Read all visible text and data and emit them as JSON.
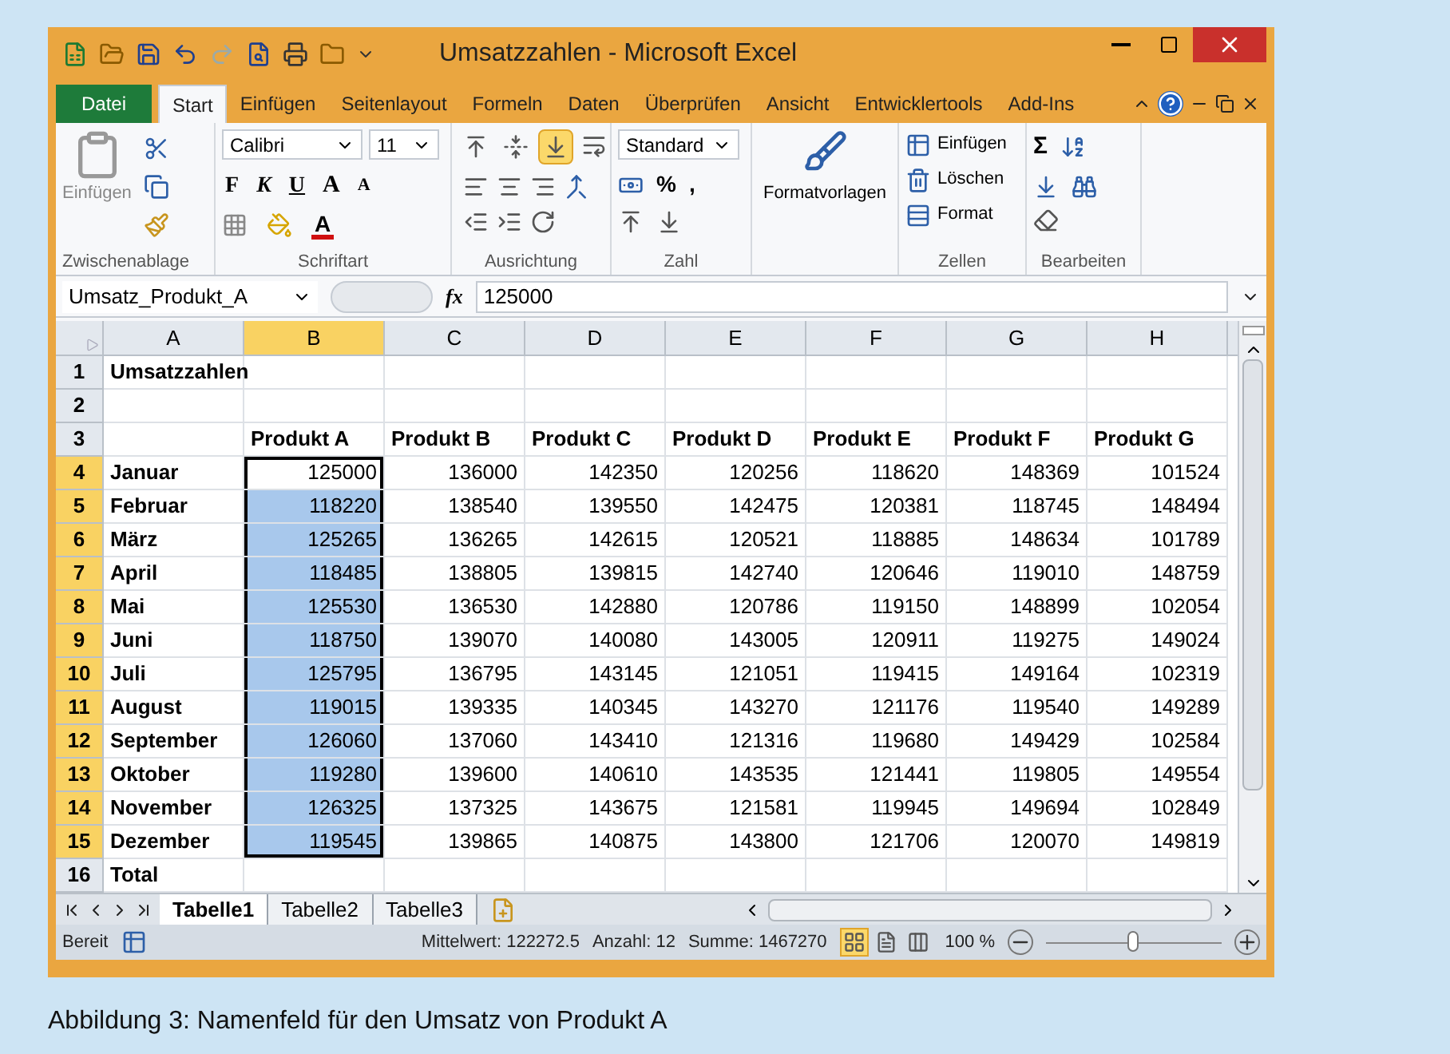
{
  "window": {
    "title": "Umsatzzahlen - Microsoft Excel"
  },
  "tabs": [
    {
      "label": "Datei",
      "kind": "file",
      "selected": false
    },
    {
      "label": "Start",
      "kind": "tab",
      "selected": true
    },
    {
      "label": "Einfügen",
      "kind": "tab",
      "selected": false
    },
    {
      "label": "Seitenlayout",
      "kind": "tab",
      "selected": false
    },
    {
      "label": "Formeln",
      "kind": "tab",
      "selected": false
    },
    {
      "label": "Daten",
      "kind": "tab",
      "selected": false
    },
    {
      "label": "Überprüfen",
      "kind": "tab",
      "selected": false
    },
    {
      "label": "Ansicht",
      "kind": "tab",
      "selected": false
    },
    {
      "label": "Entwicklertools",
      "kind": "tab",
      "selected": false
    },
    {
      "label": "Add-Ins",
      "kind": "tab",
      "selected": false
    }
  ],
  "ribbon": {
    "clipboard": {
      "label": "Zwischenablage",
      "paste": "Einfügen"
    },
    "font": {
      "label": "Schriftart",
      "family": "Calibri",
      "size": "11",
      "bold": "F",
      "italic": "K",
      "underline": "U",
      "grow": "A",
      "shrink": "A",
      "font_color": "A"
    },
    "alignment": {
      "label": "Ausrichtung",
      "vertical": [
        {
          "selected": false
        },
        {
          "selected": false
        },
        {
          "selected": true
        }
      ]
    },
    "number": {
      "label": "Zahl",
      "format": "Standard",
      "percent": "%",
      "thousands": ","
    },
    "styles": {
      "label": "Formatvorlagen"
    },
    "cells": {
      "label": "Zellen",
      "items": [
        "Einfügen",
        "Löschen",
        "Format"
      ]
    },
    "editing": {
      "label": "Bearbeiten",
      "sum": "Σ"
    }
  },
  "formula_bar": {
    "name_box": "Umsatz_Produkt_A",
    "fx": "fx",
    "value": "125000"
  },
  "sheet": {
    "columns": [
      {
        "label": "A",
        "selected": false
      },
      {
        "label": "B",
        "selected": true
      },
      {
        "label": "C",
        "selected": false
      },
      {
        "label": "D",
        "selected": false
      },
      {
        "label": "E",
        "selected": false
      },
      {
        "label": "F",
        "selected": false
      },
      {
        "label": "G",
        "selected": false
      },
      {
        "label": "H",
        "selected": false
      }
    ],
    "rows": [
      {
        "number": "1",
        "kind": "title",
        "selected": false,
        "cells": [
          "Umsatzzahlen"
        ]
      },
      {
        "number": "2",
        "kind": "blank",
        "selected": false
      },
      {
        "number": "3",
        "kind": "header",
        "selected": false,
        "cells": [
          "Produkt A",
          "Produkt B",
          "Produkt C",
          "Produkt D",
          "Produkt E",
          "Produkt F",
          "Produkt G"
        ]
      },
      {
        "number": "4",
        "kind": "data",
        "selected": true,
        "cells": [
          "Januar",
          "125000",
          "136000",
          "142350",
          "120256",
          "118620",
          "148369",
          "101524"
        ]
      },
      {
        "number": "5",
        "kind": "data",
        "selected": true,
        "cells": [
          "Februar",
          "118220",
          "138540",
          "139550",
          "142475",
          "120381",
          "118745",
          "148494"
        ]
      },
      {
        "number": "6",
        "kind": "data",
        "selected": true,
        "cells": [
          "März",
          "125265",
          "136265",
          "142615",
          "120521",
          "118885",
          "148634",
          "101789"
        ]
      },
      {
        "number": "7",
        "kind": "data",
        "selected": true,
        "cells": [
          "April",
          "118485",
          "138805",
          "139815",
          "142740",
          "120646",
          "119010",
          "148759"
        ]
      },
      {
        "number": "8",
        "kind": "data",
        "selected": true,
        "cells": [
          "Mai",
          "125530",
          "136530",
          "142880",
          "120786",
          "119150",
          "148899",
          "102054"
        ]
      },
      {
        "number": "9",
        "kind": "data",
        "selected": true,
        "cells": [
          "Juni",
          "118750",
          "139070",
          "140080",
          "143005",
          "120911",
          "119275",
          "149024"
        ]
      },
      {
        "number": "10",
        "kind": "data",
        "selected": true,
        "cells": [
          "Juli",
          "125795",
          "136795",
          "143145",
          "121051",
          "119415",
          "149164",
          "102319"
        ]
      },
      {
        "number": "11",
        "kind": "data",
        "selected": true,
        "cells": [
          "August",
          "119015",
          "139335",
          "140345",
          "143270",
          "121176",
          "119540",
          "149289"
        ]
      },
      {
        "number": "12",
        "kind": "data",
        "selected": true,
        "cells": [
          "September",
          "126060",
          "137060",
          "143410",
          "121316",
          "119680",
          "149429",
          "102584"
        ]
      },
      {
        "number": "13",
        "kind": "data",
        "selected": true,
        "cells": [
          "Oktober",
          "119280",
          "139600",
          "140610",
          "143535",
          "121441",
          "119805",
          "149554"
        ]
      },
      {
        "number": "14",
        "kind": "data",
        "selected": true,
        "cells": [
          "November",
          "126325",
          "137325",
          "143675",
          "121581",
          "119945",
          "149694",
          "102849"
        ]
      },
      {
        "number": "15",
        "kind": "data",
        "selected": true,
        "cells": [
          "Dezember",
          "119545",
          "139865",
          "140875",
          "143800",
          "121706",
          "120070",
          "149819"
        ]
      },
      {
        "number": "16",
        "kind": "total",
        "selected": false,
        "cells": [
          "Total"
        ]
      }
    ]
  },
  "sheet_tabs": [
    {
      "label": "Tabelle1",
      "selected": true
    },
    {
      "label": "Tabelle2",
      "selected": false
    },
    {
      "label": "Tabelle3",
      "selected": false
    }
  ],
  "status_bar": {
    "ready": "Bereit",
    "average": "Mittelwert: 122272.5",
    "count": "Anzahl: 12",
    "sum": "Summe: 1467270",
    "views": [
      {
        "selected": true
      },
      {
        "selected": false
      },
      {
        "selected": false
      }
    ],
    "zoom": "100 %",
    "zoom_slider": {
      "level": 0.5
    }
  },
  "caption": "Abbildung 3: Namenfeld für den Umsatz von Produkt A"
}
